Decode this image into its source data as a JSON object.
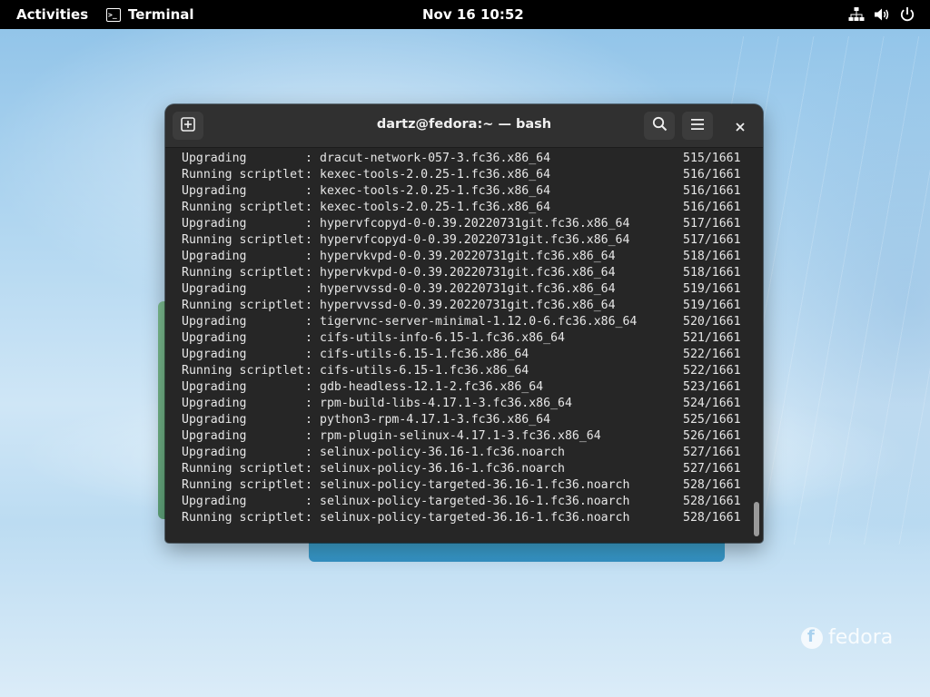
{
  "topbar": {
    "activities": "Activities",
    "app_name": "Terminal",
    "clock": "Nov 16  10:52",
    "icons": [
      "network-icon",
      "volume-icon",
      "power-icon"
    ]
  },
  "window": {
    "title": "dartz@fedora:~ — bash",
    "buttons": [
      "new-tab-icon",
      "search-icon",
      "hamburger-menu-icon",
      "close-icon"
    ]
  },
  "terminal": {
    "lines": [
      {
        "stage": "Upgrading",
        "pkg": "dracut-network-057-3.fc36.x86_64",
        "count": "515/1661"
      },
      {
        "stage": "Running scriptlet",
        "pkg": "kexec-tools-2.0.25-1.fc36.x86_64",
        "count": "516/1661"
      },
      {
        "stage": "Upgrading",
        "pkg": "kexec-tools-2.0.25-1.fc36.x86_64",
        "count": "516/1661"
      },
      {
        "stage": "Running scriptlet",
        "pkg": "kexec-tools-2.0.25-1.fc36.x86_64",
        "count": "516/1661"
      },
      {
        "stage": "Upgrading",
        "pkg": "hypervfcopyd-0-0.39.20220731git.fc36.x86_64",
        "count": "517/1661"
      },
      {
        "stage": "Running scriptlet",
        "pkg": "hypervfcopyd-0-0.39.20220731git.fc36.x86_64",
        "count": "517/1661"
      },
      {
        "stage": "Upgrading",
        "pkg": "hypervkvpd-0-0.39.20220731git.fc36.x86_64",
        "count": "518/1661"
      },
      {
        "stage": "Running scriptlet",
        "pkg": "hypervkvpd-0-0.39.20220731git.fc36.x86_64",
        "count": "518/1661"
      },
      {
        "stage": "Upgrading",
        "pkg": "hypervvssd-0-0.39.20220731git.fc36.x86_64",
        "count": "519/1661"
      },
      {
        "stage": "Running scriptlet",
        "pkg": "hypervvssd-0-0.39.20220731git.fc36.x86_64",
        "count": "519/1661"
      },
      {
        "stage": "Upgrading",
        "pkg": "tigervnc-server-minimal-1.12.0-6.fc36.x86_64",
        "count": "520/1661"
      },
      {
        "stage": "Upgrading",
        "pkg": "cifs-utils-info-6.15-1.fc36.x86_64",
        "count": "521/1661"
      },
      {
        "stage": "Upgrading",
        "pkg": "cifs-utils-6.15-1.fc36.x86_64",
        "count": "522/1661"
      },
      {
        "stage": "Running scriptlet",
        "pkg": "cifs-utils-6.15-1.fc36.x86_64",
        "count": "522/1661"
      },
      {
        "stage": "Upgrading",
        "pkg": "gdb-headless-12.1-2.fc36.x86_64",
        "count": "523/1661"
      },
      {
        "stage": "Upgrading",
        "pkg": "rpm-build-libs-4.17.1-3.fc36.x86_64",
        "count": "524/1661"
      },
      {
        "stage": "Upgrading",
        "pkg": "python3-rpm-4.17.1-3.fc36.x86_64",
        "count": "525/1661"
      },
      {
        "stage": "Upgrading",
        "pkg": "rpm-plugin-selinux-4.17.1-3.fc36.x86_64",
        "count": "526/1661"
      },
      {
        "stage": "Upgrading",
        "pkg": "selinux-policy-36.16-1.fc36.noarch",
        "count": "527/1661"
      },
      {
        "stage": "Running scriptlet",
        "pkg": "selinux-policy-36.16-1.fc36.noarch",
        "count": "527/1661"
      },
      {
        "stage": "Running scriptlet",
        "pkg": "selinux-policy-targeted-36.16-1.fc36.noarch",
        "count": "528/1661"
      },
      {
        "stage": "Upgrading",
        "pkg": "selinux-policy-targeted-36.16-1.fc36.noarch",
        "count": "528/1661"
      },
      {
        "stage": "Running scriptlet",
        "pkg": "selinux-policy-targeted-36.16-1.fc36.noarch",
        "count": "528/1661"
      }
    ]
  },
  "desktop": {
    "logo_text": "fedora"
  }
}
